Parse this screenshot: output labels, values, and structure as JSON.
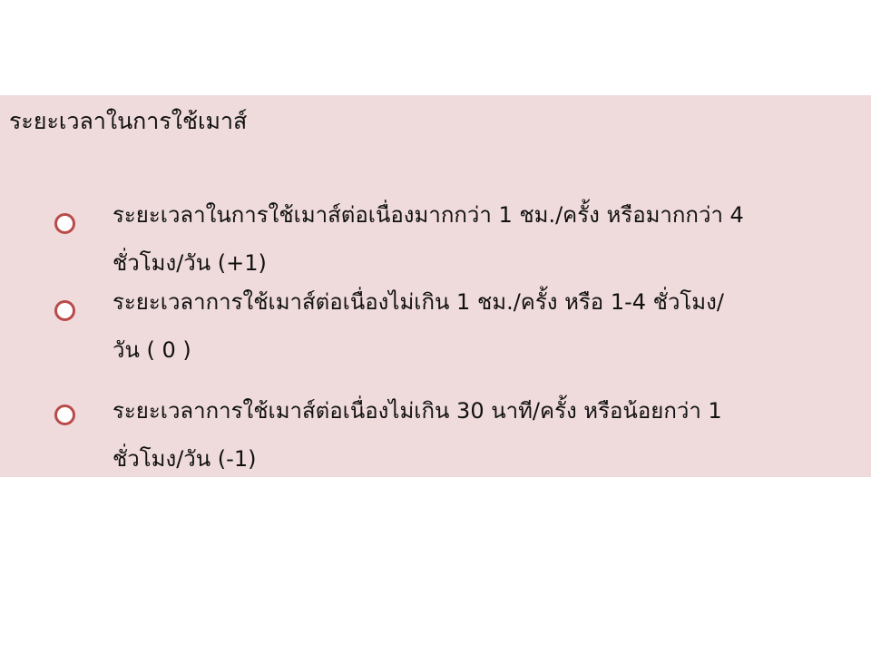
{
  "question": {
    "title": "ระยะเวลาในการใช้เมาส์"
  },
  "options": [
    {
      "line1": "ระยะเวลาในการใช้เมาส์ต่อเนื่องมากกว่า 1 ชม./ครั้ง หรือมากกว่า 4",
      "line2": "ชั่วโมง/วัน (+1)",
      "selected": false
    },
    {
      "line1": "ระยะเวลาการใช้เมาส์ต่อเนื่องไม่เกิน 1 ชม./ครั้ง หรือ 1-4 ชั่วโมง/",
      "line2": "วัน ( 0 )",
      "selected": false
    },
    {
      "line1": "ระยะเวลาการใช้เมาส์ต่อเนื่องไม่เกิน 30 นาที/ครั้ง หรือน้อยกว่า 1",
      "line2": "ชั่วโมง/วัน (-1)",
      "selected": false
    }
  ],
  "colors": {
    "panel_background": "#f0dbdc",
    "radio_border": "#b94a4a",
    "text": "#111111"
  }
}
